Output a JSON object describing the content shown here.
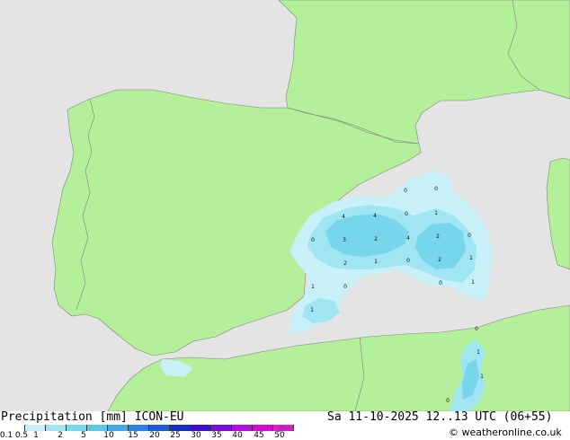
{
  "footer": {
    "product": "Precipitation [mm]",
    "model": "ICON-EU",
    "valid_time": "Sa 11-10-2025 12..13 UTC (06+55)",
    "copyright": "© weatheronline.co.uk"
  },
  "legend": {
    "ticks": [
      "0.1",
      "0.5",
      "1",
      "2",
      "5",
      "10",
      "15",
      "20",
      "25",
      "30",
      "35",
      "40",
      "45",
      "50"
    ],
    "colors": [
      "#ffffff",
      "#c8f0f8",
      "#a0e6f2",
      "#78d6ec",
      "#5cc8e6",
      "#46a6e8",
      "#2f7fe0",
      "#1e5cd8",
      "#1230b8",
      "#3a10c8",
      "#7a10d8",
      "#b010e0",
      "#d010d0",
      "#e020c0"
    ]
  },
  "map": {
    "land_color": "#b4f09a",
    "sea_color": "#e4e4e4",
    "border_color": "#808080",
    "precip_values": [
      {
        "label": "0"
      },
      {
        "label": "0"
      },
      {
        "label": "4"
      },
      {
        "label": "4"
      },
      {
        "label": "0"
      },
      {
        "label": "1"
      },
      {
        "label": "0"
      },
      {
        "label": "3"
      },
      {
        "label": "2"
      },
      {
        "label": "4"
      },
      {
        "label": "2"
      },
      {
        "label": "0"
      },
      {
        "label": "2"
      },
      {
        "label": "1"
      },
      {
        "label": "0"
      },
      {
        "label": "2"
      },
      {
        "label": "1"
      },
      {
        "label": "1"
      },
      {
        "label": "0"
      },
      {
        "label": "1"
      },
      {
        "label": "0"
      },
      {
        "label": "1"
      },
      {
        "label": "0"
      },
      {
        "label": "1"
      },
      {
        "label": "1"
      },
      {
        "label": "0"
      }
    ]
  }
}
